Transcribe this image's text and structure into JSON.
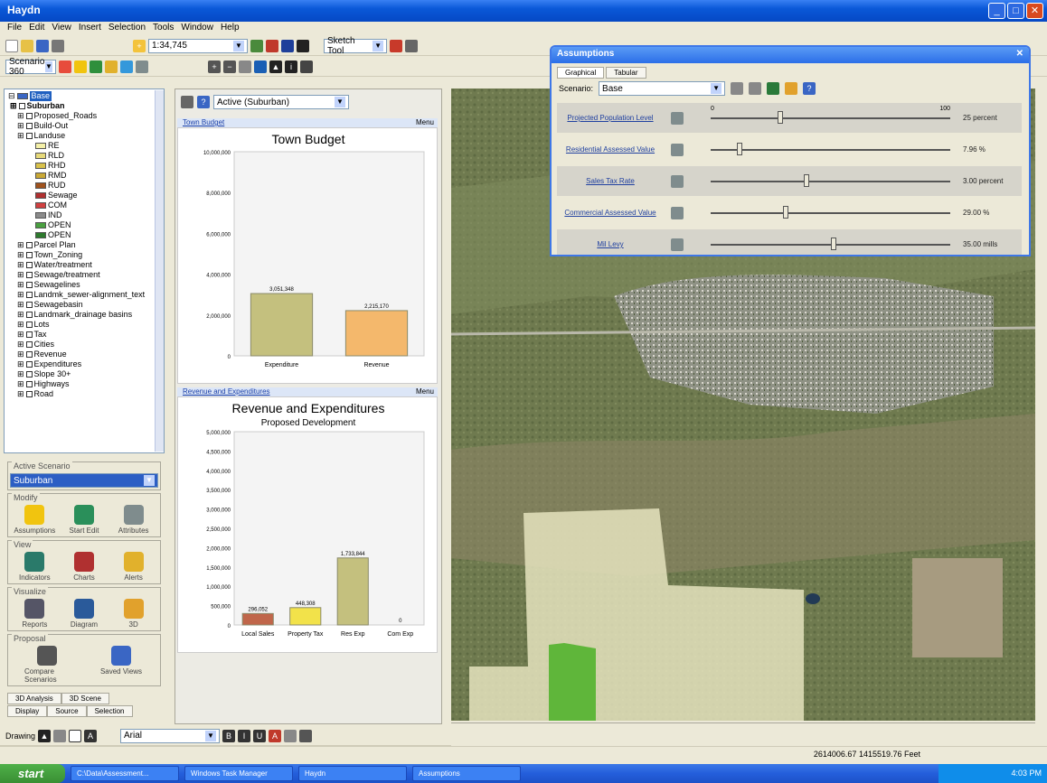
{
  "window": {
    "title": "Haydn"
  },
  "menu": [
    "File",
    "Edit",
    "View",
    "Insert",
    "Selection",
    "Tools",
    "Window",
    "Help"
  ],
  "toolbar1": {
    "scale": "1:34,745",
    "extension_label": "Sketch Tool"
  },
  "toolbar2": {
    "scenario_label": "Scenario 360"
  },
  "toc": {
    "root": "Base",
    "layers": [
      {
        "label": "Suburban",
        "kind": "group"
      },
      {
        "label": "Proposed_Roads",
        "kind": "layer"
      },
      {
        "label": "Build-Out",
        "kind": "layer"
      },
      {
        "label": "Landuse",
        "kind": "layer"
      },
      {
        "label": "RE",
        "kind": "legend",
        "color": "#f4f0a8"
      },
      {
        "label": "RLD",
        "kind": "legend",
        "color": "#e6d97a"
      },
      {
        "label": "RHD",
        "kind": "legend",
        "color": "#d8c14b"
      },
      {
        "label": "RMD",
        "kind": "legend",
        "color": "#c9a835"
      },
      {
        "label": "RUD",
        "kind": "legend",
        "color": "#a0521d"
      },
      {
        "label": "Sewage",
        "kind": "legend",
        "color": "#b03030"
      },
      {
        "label": "COM",
        "kind": "legend",
        "color": "#d04040"
      },
      {
        "label": "IND",
        "kind": "legend",
        "color": "#8a8a8a"
      },
      {
        "label": "OPEN",
        "kind": "legend",
        "color": "#4aa040"
      },
      {
        "label": "OPEN",
        "kind": "legend",
        "color": "#2d7a2d"
      },
      {
        "label": "Parcel Plan",
        "kind": "layer"
      },
      {
        "label": "Town_Zoning",
        "kind": "layer"
      },
      {
        "label": "Water/treatment",
        "kind": "layer"
      },
      {
        "label": "Sewage/treatment",
        "kind": "layer"
      },
      {
        "label": "Sewagelines",
        "kind": "layer"
      },
      {
        "label": "Landmk_sewer-alignment_text",
        "kind": "layer"
      },
      {
        "label": "Sewagebasin",
        "kind": "layer"
      },
      {
        "label": "Landmark_drainage basins",
        "kind": "layer"
      },
      {
        "label": "Lots",
        "kind": "layer"
      },
      {
        "label": "Tax",
        "kind": "layer"
      },
      {
        "label": "Cities",
        "kind": "layer"
      },
      {
        "label": "Revenue",
        "kind": "layer"
      },
      {
        "label": "Expenditures",
        "kind": "layer"
      },
      {
        "label": "Slope 30+",
        "kind": "layer"
      },
      {
        "label": "Highways",
        "kind": "layer"
      },
      {
        "label": "Road",
        "kind": "layer"
      }
    ]
  },
  "scenarios": {
    "active_title": "Active Scenario",
    "active_value": "Suburban",
    "groups": [
      {
        "title": "Modify",
        "buttons": [
          "Assumptions",
          "Start Edit",
          "Attributes"
        ]
      },
      {
        "title": "View",
        "buttons": [
          "Indicators",
          "Charts",
          "Alerts"
        ]
      },
      {
        "title": "Visualize",
        "buttons": [
          "Reports",
          "Diagram",
          "3D"
        ]
      },
      {
        "title": "Proposal",
        "buttons": [
          "Compare Scenarios",
          "Saved Views"
        ]
      }
    ],
    "tabs_top": [
      "3D Analysis",
      "3D Scene"
    ],
    "tabs_bottom": [
      "Display",
      "Source",
      "Selection"
    ]
  },
  "charts_panel": {
    "active_combo": "Active (Suburban)",
    "chart1_header": "Town Budget",
    "chart2_header": "Revenue and Expenditures",
    "menu_label": "Menu"
  },
  "chart_data": [
    {
      "type": "bar",
      "title": "Town Budget",
      "categories": [
        "Expenditure",
        "Revenue"
      ],
      "values": [
        3051348,
        2215170
      ],
      "value_labels": [
        "3,051,348",
        "2,215,170"
      ],
      "colors": [
        "#c4c07e",
        "#f4b86c"
      ],
      "y_ticks": [
        "10,000,000",
        "8,000,000",
        "6,000,000",
        "4,000,000",
        "2,000,000",
        "0"
      ],
      "ylim": [
        0,
        10000000
      ]
    },
    {
      "type": "bar",
      "title": "Revenue and Expenditures",
      "subtitle": "Proposed Development",
      "categories": [
        "Local Sales",
        "Property Tax",
        "Res Exp",
        "Com Exp"
      ],
      "values": [
        296052,
        448308,
        1733844,
        0
      ],
      "value_labels": [
        "296,052",
        "448,308",
        "1,733,844",
        "0"
      ],
      "colors": [
        "#c0664a",
        "#f2e24a",
        "#c4c07e",
        "#c4c07e"
      ],
      "y_ticks": [
        "5,000,000",
        "4,500,000",
        "4,000,000",
        "3,500,000",
        "3,000,000",
        "2,500,000",
        "2,000,000",
        "1,500,000",
        "1,000,000",
        "500,000",
        "0"
      ],
      "ylim": [
        0,
        5000000
      ]
    }
  ],
  "assumptions": {
    "title": "Assumptions",
    "tabs": [
      "Graphical",
      "Tabular"
    ],
    "scenario_label": "Scenario:",
    "scenario_value": "Base",
    "rows": [
      {
        "label": "Projected Population Level",
        "value": "25  percent",
        "pos": 0.28,
        "range_lo": "0",
        "range_hi": "100"
      },
      {
        "label": "Residential Assessed Value",
        "value": "7.96  %",
        "pos": 0.11
      },
      {
        "label": "Sales Tax Rate",
        "value": "3.00  percent",
        "pos": 0.39
      },
      {
        "label": "Commercial Assessed Value",
        "value": "29.00  %",
        "pos": 0.3
      },
      {
        "label": "Mil Levy",
        "value": "35.00  mills",
        "pos": 0.5
      }
    ]
  },
  "drawing_toolbar": {
    "label": "Drawing",
    "font": "Arial"
  },
  "status": {
    "coords": "2614006.67  1415519.76 Feet"
  },
  "taskbar": {
    "start": "start",
    "tasks": [
      "C:\\Data\\Assessment...",
      "Windows Task Manager",
      "Haydn",
      "Assumptions"
    ],
    "clock": "4:03 PM"
  }
}
